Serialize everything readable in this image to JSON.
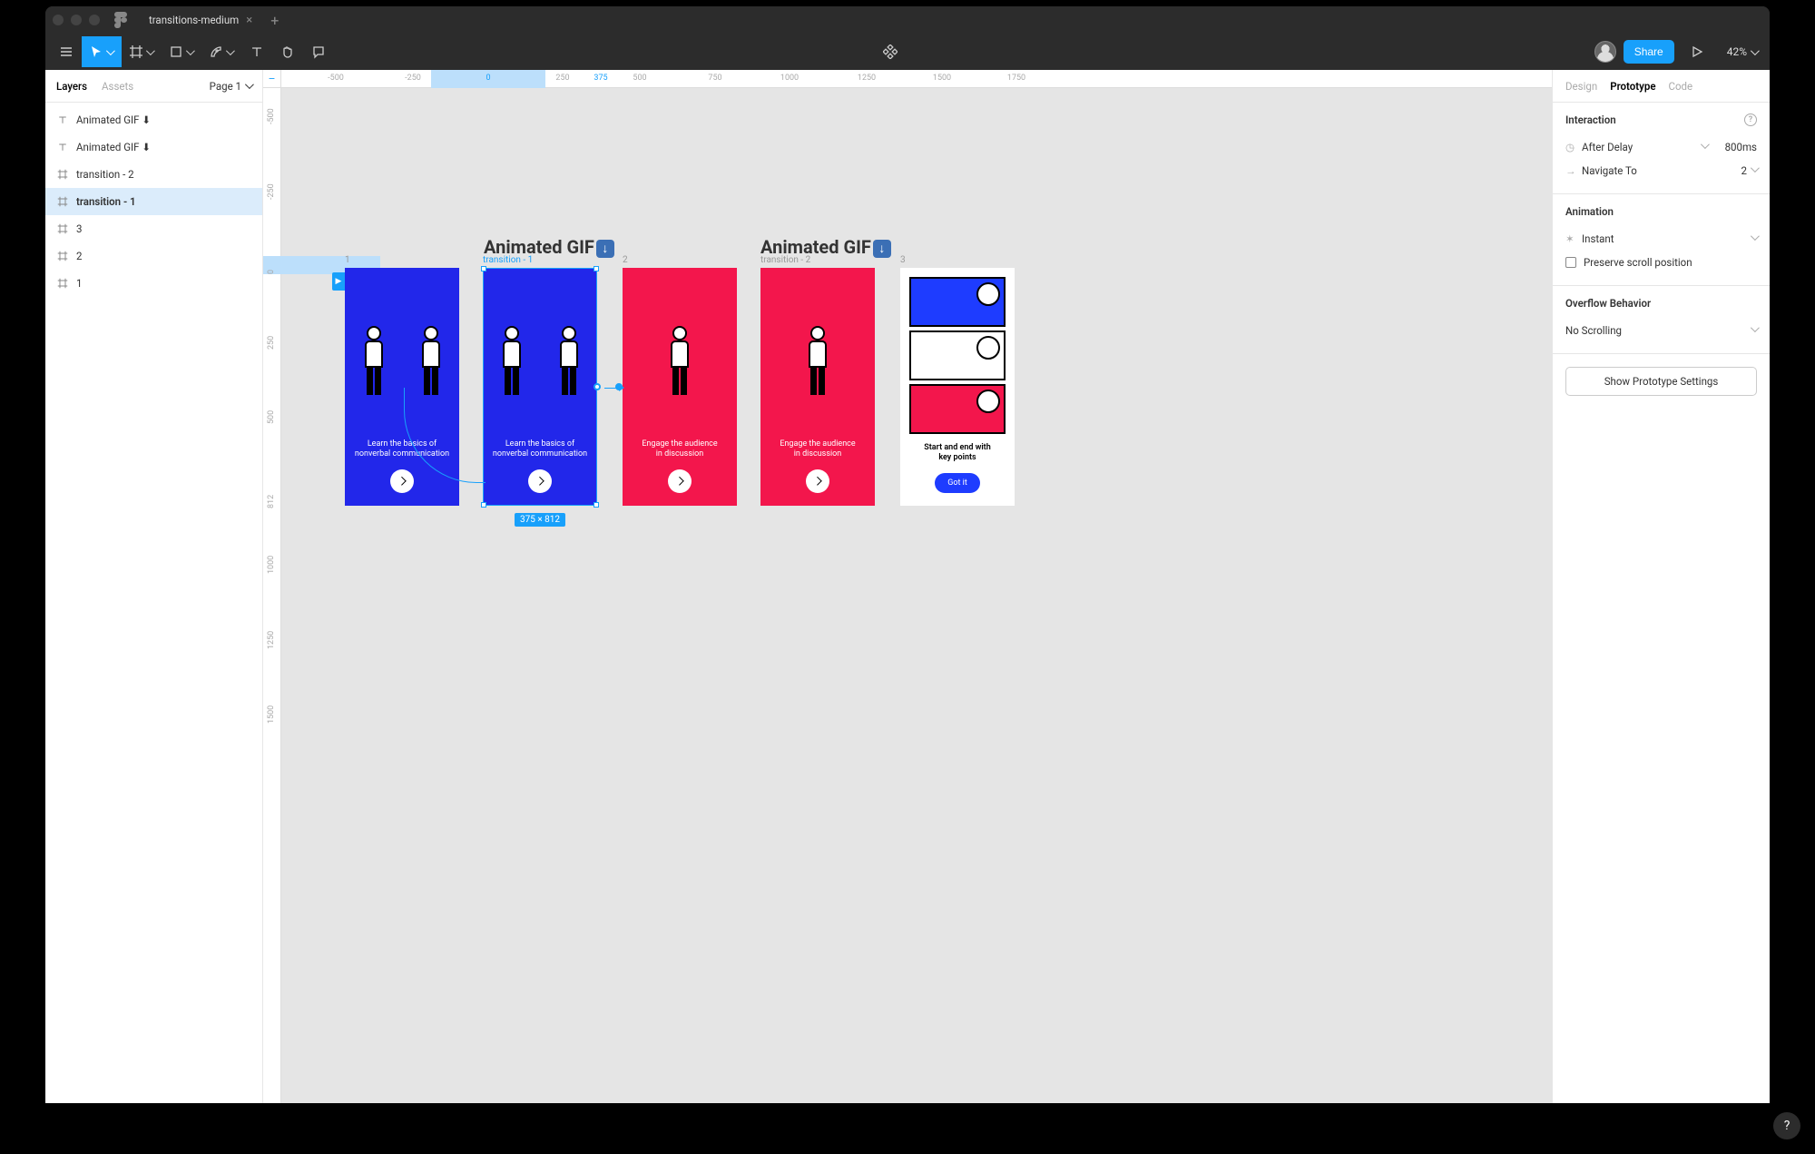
{
  "titlebar": {
    "tab_name": "transitions-medium"
  },
  "toolbar": {
    "share": "Share",
    "zoom": "42%"
  },
  "left": {
    "tabs": {
      "layers": "Layers",
      "assets": "Assets"
    },
    "page": "Page 1",
    "items": [
      {
        "icon": "text",
        "name": "Animated GIF ⬇"
      },
      {
        "icon": "text",
        "name": "Animated GIF ⬇"
      },
      {
        "icon": "frame",
        "name": "transition - 2"
      },
      {
        "icon": "frame",
        "name": "transition - 1",
        "selected": true
      },
      {
        "icon": "frame",
        "name": "3"
      },
      {
        "icon": "frame",
        "name": "2"
      },
      {
        "icon": "frame",
        "name": "1"
      }
    ]
  },
  "ruler": {
    "top": [
      "-500",
      "-250",
      "0",
      "250",
      "375",
      "500",
      "750",
      "1000",
      "1250",
      "1500",
      "1750"
    ],
    "left": [
      "-500",
      "-250",
      "0",
      "250",
      "500",
      "812",
      "1000",
      "1250",
      "1500"
    ]
  },
  "canvas": {
    "titles": [
      "Animated GIF",
      "Animated GIF"
    ],
    "frames": [
      {
        "label": "1",
        "color": "blue",
        "caption": "Learn the basics of\nnonverbal communication",
        "button": "arrow"
      },
      {
        "label": "transition - 1",
        "color": "blue",
        "caption": "Learn the basics of\nnonverbal communication",
        "button": "arrow",
        "selected": true
      },
      {
        "label": "2",
        "color": "red",
        "caption": "Engage the audience\nin discussion",
        "button": "arrow"
      },
      {
        "label": "transition - 2",
        "color": "red",
        "caption": "Engage the audience\nin discussion",
        "button": "arrow"
      },
      {
        "label": "3",
        "color": "white",
        "caption": "Start and end with\nkey points",
        "button": "gotit",
        "button_label": "Got it"
      }
    ],
    "selection_dims": "375 × 812"
  },
  "right": {
    "tabs": {
      "design": "Design",
      "prototype": "Prototype",
      "code": "Code"
    },
    "interaction": {
      "title": "Interaction",
      "trigger": "After Delay",
      "trigger_val": "800ms",
      "action": "Navigate To",
      "action_val": "2"
    },
    "animation": {
      "title": "Animation",
      "type": "Instant",
      "preserve": "Preserve scroll position"
    },
    "overflow": {
      "title": "Overflow Behavior",
      "value": "No Scrolling"
    },
    "settings_btn": "Show Prototype Settings"
  }
}
